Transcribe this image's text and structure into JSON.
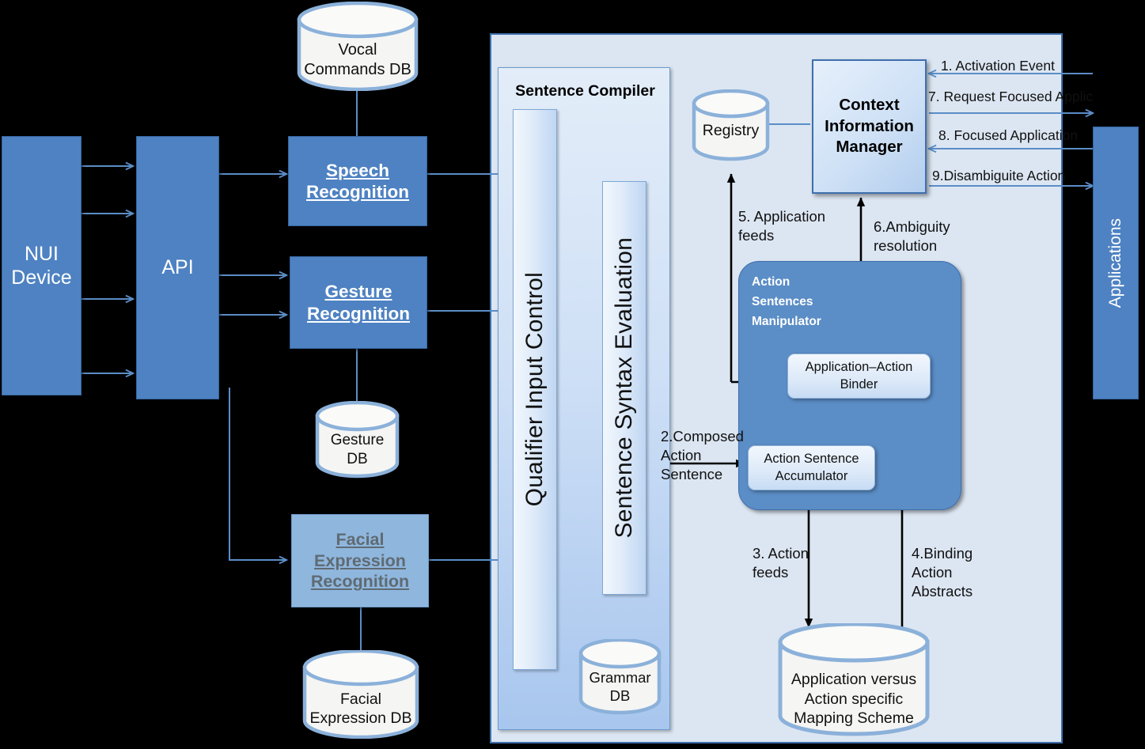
{
  "diagram": {
    "title": "NUI multimodal sentence compiler architecture",
    "colors": {
      "solid_blue": "#4E82C2",
      "pale_blue": "#8FB6DD",
      "panel_bg": "#DCE6F2",
      "manipulator_blue": "#5B8DC6",
      "border_blue": "#3F6FAE",
      "cylinder_stroke": "#8BB1DA",
      "cylinder_fill": "#F3F3F1",
      "arrow_blue": "#5B8DC6",
      "arrow_black": "#000000",
      "background": "#000000"
    }
  },
  "left_column": {
    "nui_device": "NUI\nDevice",
    "api": "API"
  },
  "recognizers": [
    {
      "id": "speech",
      "line1": "Speech",
      "line2": "Recognition",
      "line3": "",
      "style": "solid"
    },
    {
      "id": "gesture",
      "line1": "Gesture",
      "line2": "Recognition",
      "line3": "",
      "style": "solid"
    },
    {
      "id": "facial",
      "line1": "Facial",
      "line2": "Expression",
      "line3": "Recognition",
      "style": "pale"
    }
  ],
  "databases": {
    "vocal_commands": "Vocal\nCommands DB",
    "gesture": "Gesture\nDB",
    "facial_expression": "Facial\nExpression DB",
    "grammar": "Grammar\nDB",
    "registry": "Registry",
    "mapping_scheme": "Application versus\nAction specific\nMapping Scheme"
  },
  "compiler": {
    "title": "Sentence Compiler",
    "qualifier_input_control": "Qualifier Input Control",
    "sentence_syntax_evaluation": "Sentence Syntax Evaluation"
  },
  "manipulator": {
    "title": "Action\nSentences\nManipulator",
    "binder": "Application–Action\nBinder",
    "accumulator": "Action Sentence\nAccumulator"
  },
  "context_manager": {
    "title": "Context\nInformation\nManager"
  },
  "applications": {
    "label": "Applications"
  },
  "flow_labels": [
    {
      "n": "1",
      "text": "1. Activation Event"
    },
    {
      "n": "2",
      "text": "2.Composed\nAction\nSentence"
    },
    {
      "n": "3",
      "text": "3. Action\nfeeds"
    },
    {
      "n": "4",
      "text": "4.Binding\nAction\nAbstracts"
    },
    {
      "n": "5",
      "text": "5. Application\nfeeds"
    },
    {
      "n": "6",
      "text": "6.Ambiguity\nresolution"
    },
    {
      "n": "7",
      "text": "7. Request Focused Applic"
    },
    {
      "n": "8",
      "text": "8. Focused Application"
    },
    {
      "n": "9",
      "text": "9.Disambiguite Action"
    }
  ]
}
